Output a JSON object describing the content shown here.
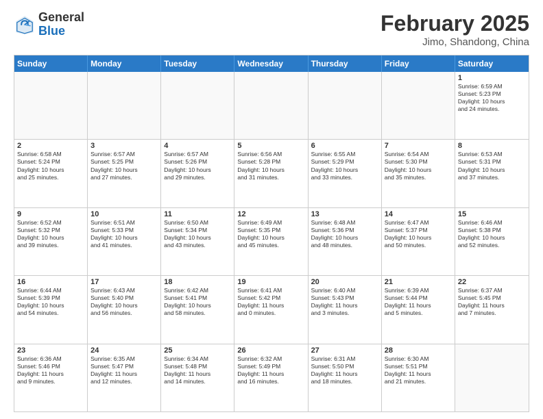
{
  "header": {
    "logo_general": "General",
    "logo_blue": "Blue",
    "month_year": "February 2025",
    "location": "Jimo, Shandong, China"
  },
  "weekdays": [
    "Sunday",
    "Monday",
    "Tuesday",
    "Wednesday",
    "Thursday",
    "Friday",
    "Saturday"
  ],
  "rows": [
    [
      {
        "day": "",
        "text": ""
      },
      {
        "day": "",
        "text": ""
      },
      {
        "day": "",
        "text": ""
      },
      {
        "day": "",
        "text": ""
      },
      {
        "day": "",
        "text": ""
      },
      {
        "day": "",
        "text": ""
      },
      {
        "day": "1",
        "text": "Sunrise: 6:59 AM\nSunset: 5:23 PM\nDaylight: 10 hours\nand 24 minutes."
      }
    ],
    [
      {
        "day": "2",
        "text": "Sunrise: 6:58 AM\nSunset: 5:24 PM\nDaylight: 10 hours\nand 25 minutes."
      },
      {
        "day": "3",
        "text": "Sunrise: 6:57 AM\nSunset: 5:25 PM\nDaylight: 10 hours\nand 27 minutes."
      },
      {
        "day": "4",
        "text": "Sunrise: 6:57 AM\nSunset: 5:26 PM\nDaylight: 10 hours\nand 29 minutes."
      },
      {
        "day": "5",
        "text": "Sunrise: 6:56 AM\nSunset: 5:28 PM\nDaylight: 10 hours\nand 31 minutes."
      },
      {
        "day": "6",
        "text": "Sunrise: 6:55 AM\nSunset: 5:29 PM\nDaylight: 10 hours\nand 33 minutes."
      },
      {
        "day": "7",
        "text": "Sunrise: 6:54 AM\nSunset: 5:30 PM\nDaylight: 10 hours\nand 35 minutes."
      },
      {
        "day": "8",
        "text": "Sunrise: 6:53 AM\nSunset: 5:31 PM\nDaylight: 10 hours\nand 37 minutes."
      }
    ],
    [
      {
        "day": "9",
        "text": "Sunrise: 6:52 AM\nSunset: 5:32 PM\nDaylight: 10 hours\nand 39 minutes."
      },
      {
        "day": "10",
        "text": "Sunrise: 6:51 AM\nSunset: 5:33 PM\nDaylight: 10 hours\nand 41 minutes."
      },
      {
        "day": "11",
        "text": "Sunrise: 6:50 AM\nSunset: 5:34 PM\nDaylight: 10 hours\nand 43 minutes."
      },
      {
        "day": "12",
        "text": "Sunrise: 6:49 AM\nSunset: 5:35 PM\nDaylight: 10 hours\nand 45 minutes."
      },
      {
        "day": "13",
        "text": "Sunrise: 6:48 AM\nSunset: 5:36 PM\nDaylight: 10 hours\nand 48 minutes."
      },
      {
        "day": "14",
        "text": "Sunrise: 6:47 AM\nSunset: 5:37 PM\nDaylight: 10 hours\nand 50 minutes."
      },
      {
        "day": "15",
        "text": "Sunrise: 6:46 AM\nSunset: 5:38 PM\nDaylight: 10 hours\nand 52 minutes."
      }
    ],
    [
      {
        "day": "16",
        "text": "Sunrise: 6:44 AM\nSunset: 5:39 PM\nDaylight: 10 hours\nand 54 minutes."
      },
      {
        "day": "17",
        "text": "Sunrise: 6:43 AM\nSunset: 5:40 PM\nDaylight: 10 hours\nand 56 minutes."
      },
      {
        "day": "18",
        "text": "Sunrise: 6:42 AM\nSunset: 5:41 PM\nDaylight: 10 hours\nand 58 minutes."
      },
      {
        "day": "19",
        "text": "Sunrise: 6:41 AM\nSunset: 5:42 PM\nDaylight: 11 hours\nand 0 minutes."
      },
      {
        "day": "20",
        "text": "Sunrise: 6:40 AM\nSunset: 5:43 PM\nDaylight: 11 hours\nand 3 minutes."
      },
      {
        "day": "21",
        "text": "Sunrise: 6:39 AM\nSunset: 5:44 PM\nDaylight: 11 hours\nand 5 minutes."
      },
      {
        "day": "22",
        "text": "Sunrise: 6:37 AM\nSunset: 5:45 PM\nDaylight: 11 hours\nand 7 minutes."
      }
    ],
    [
      {
        "day": "23",
        "text": "Sunrise: 6:36 AM\nSunset: 5:46 PM\nDaylight: 11 hours\nand 9 minutes."
      },
      {
        "day": "24",
        "text": "Sunrise: 6:35 AM\nSunset: 5:47 PM\nDaylight: 11 hours\nand 12 minutes."
      },
      {
        "day": "25",
        "text": "Sunrise: 6:34 AM\nSunset: 5:48 PM\nDaylight: 11 hours\nand 14 minutes."
      },
      {
        "day": "26",
        "text": "Sunrise: 6:32 AM\nSunset: 5:49 PM\nDaylight: 11 hours\nand 16 minutes."
      },
      {
        "day": "27",
        "text": "Sunrise: 6:31 AM\nSunset: 5:50 PM\nDaylight: 11 hours\nand 18 minutes."
      },
      {
        "day": "28",
        "text": "Sunrise: 6:30 AM\nSunset: 5:51 PM\nDaylight: 11 hours\nand 21 minutes."
      },
      {
        "day": "",
        "text": ""
      }
    ]
  ]
}
